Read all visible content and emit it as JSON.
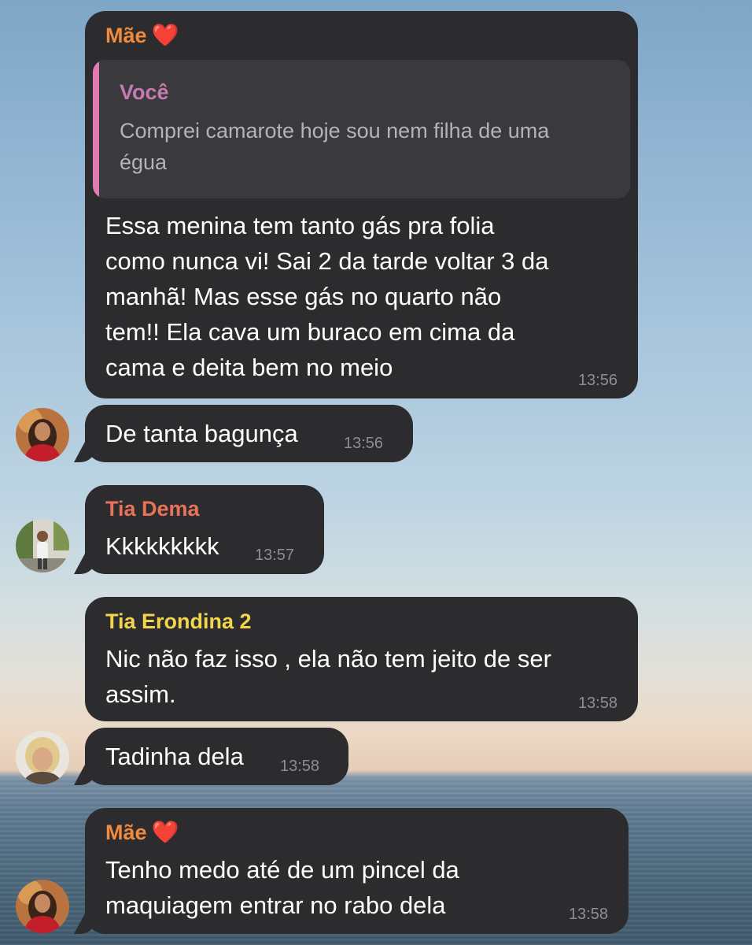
{
  "colors": {
    "bubble": "#2c2c2e",
    "mae": "#f08a3c",
    "voce": "#c87ab3",
    "tia_dema": "#e8725a",
    "tia_erondina": "#f2d54b",
    "timestamp": "#8e8e93",
    "quote_bar": "#e07bb5"
  },
  "messages": [
    {
      "sender": "Mãe",
      "sender_emoji": "❤️",
      "quote": {
        "sender": "Você",
        "text": "Comprei camarote hoje sou nem filha de uma\négua"
      },
      "text": "Essa menina tem tanto gás pra folia\ncomo nunca vi! Sai 2 da tarde voltar 3 da\nmanhã! Mas esse gás no quarto não\ntem!! Ela cava um buraco em cima da\ncama e deita bem no meio",
      "time": "13:56"
    },
    {
      "text": "De tanta bagunça",
      "time": "13:56",
      "avatar": "avatar-mae"
    },
    {
      "sender": "Tia Dema",
      "text": "Kkkkkkkkk",
      "time": "13:57",
      "avatar": "avatar-tia-dema"
    },
    {
      "sender": "Tia Erondina 2",
      "text": "Nic não faz isso , ela não tem jeito de ser\nassim.",
      "time": "13:58"
    },
    {
      "text": "Tadinha dela",
      "time": "13:58",
      "avatar": "avatar-tia-erondina"
    },
    {
      "sender": "Mãe",
      "sender_emoji": "❤️",
      "text": "Tenho medo até de um pincel da\nmaquiagem entrar no rabo dela",
      "time": "13:58",
      "avatar": "avatar-mae"
    }
  ]
}
